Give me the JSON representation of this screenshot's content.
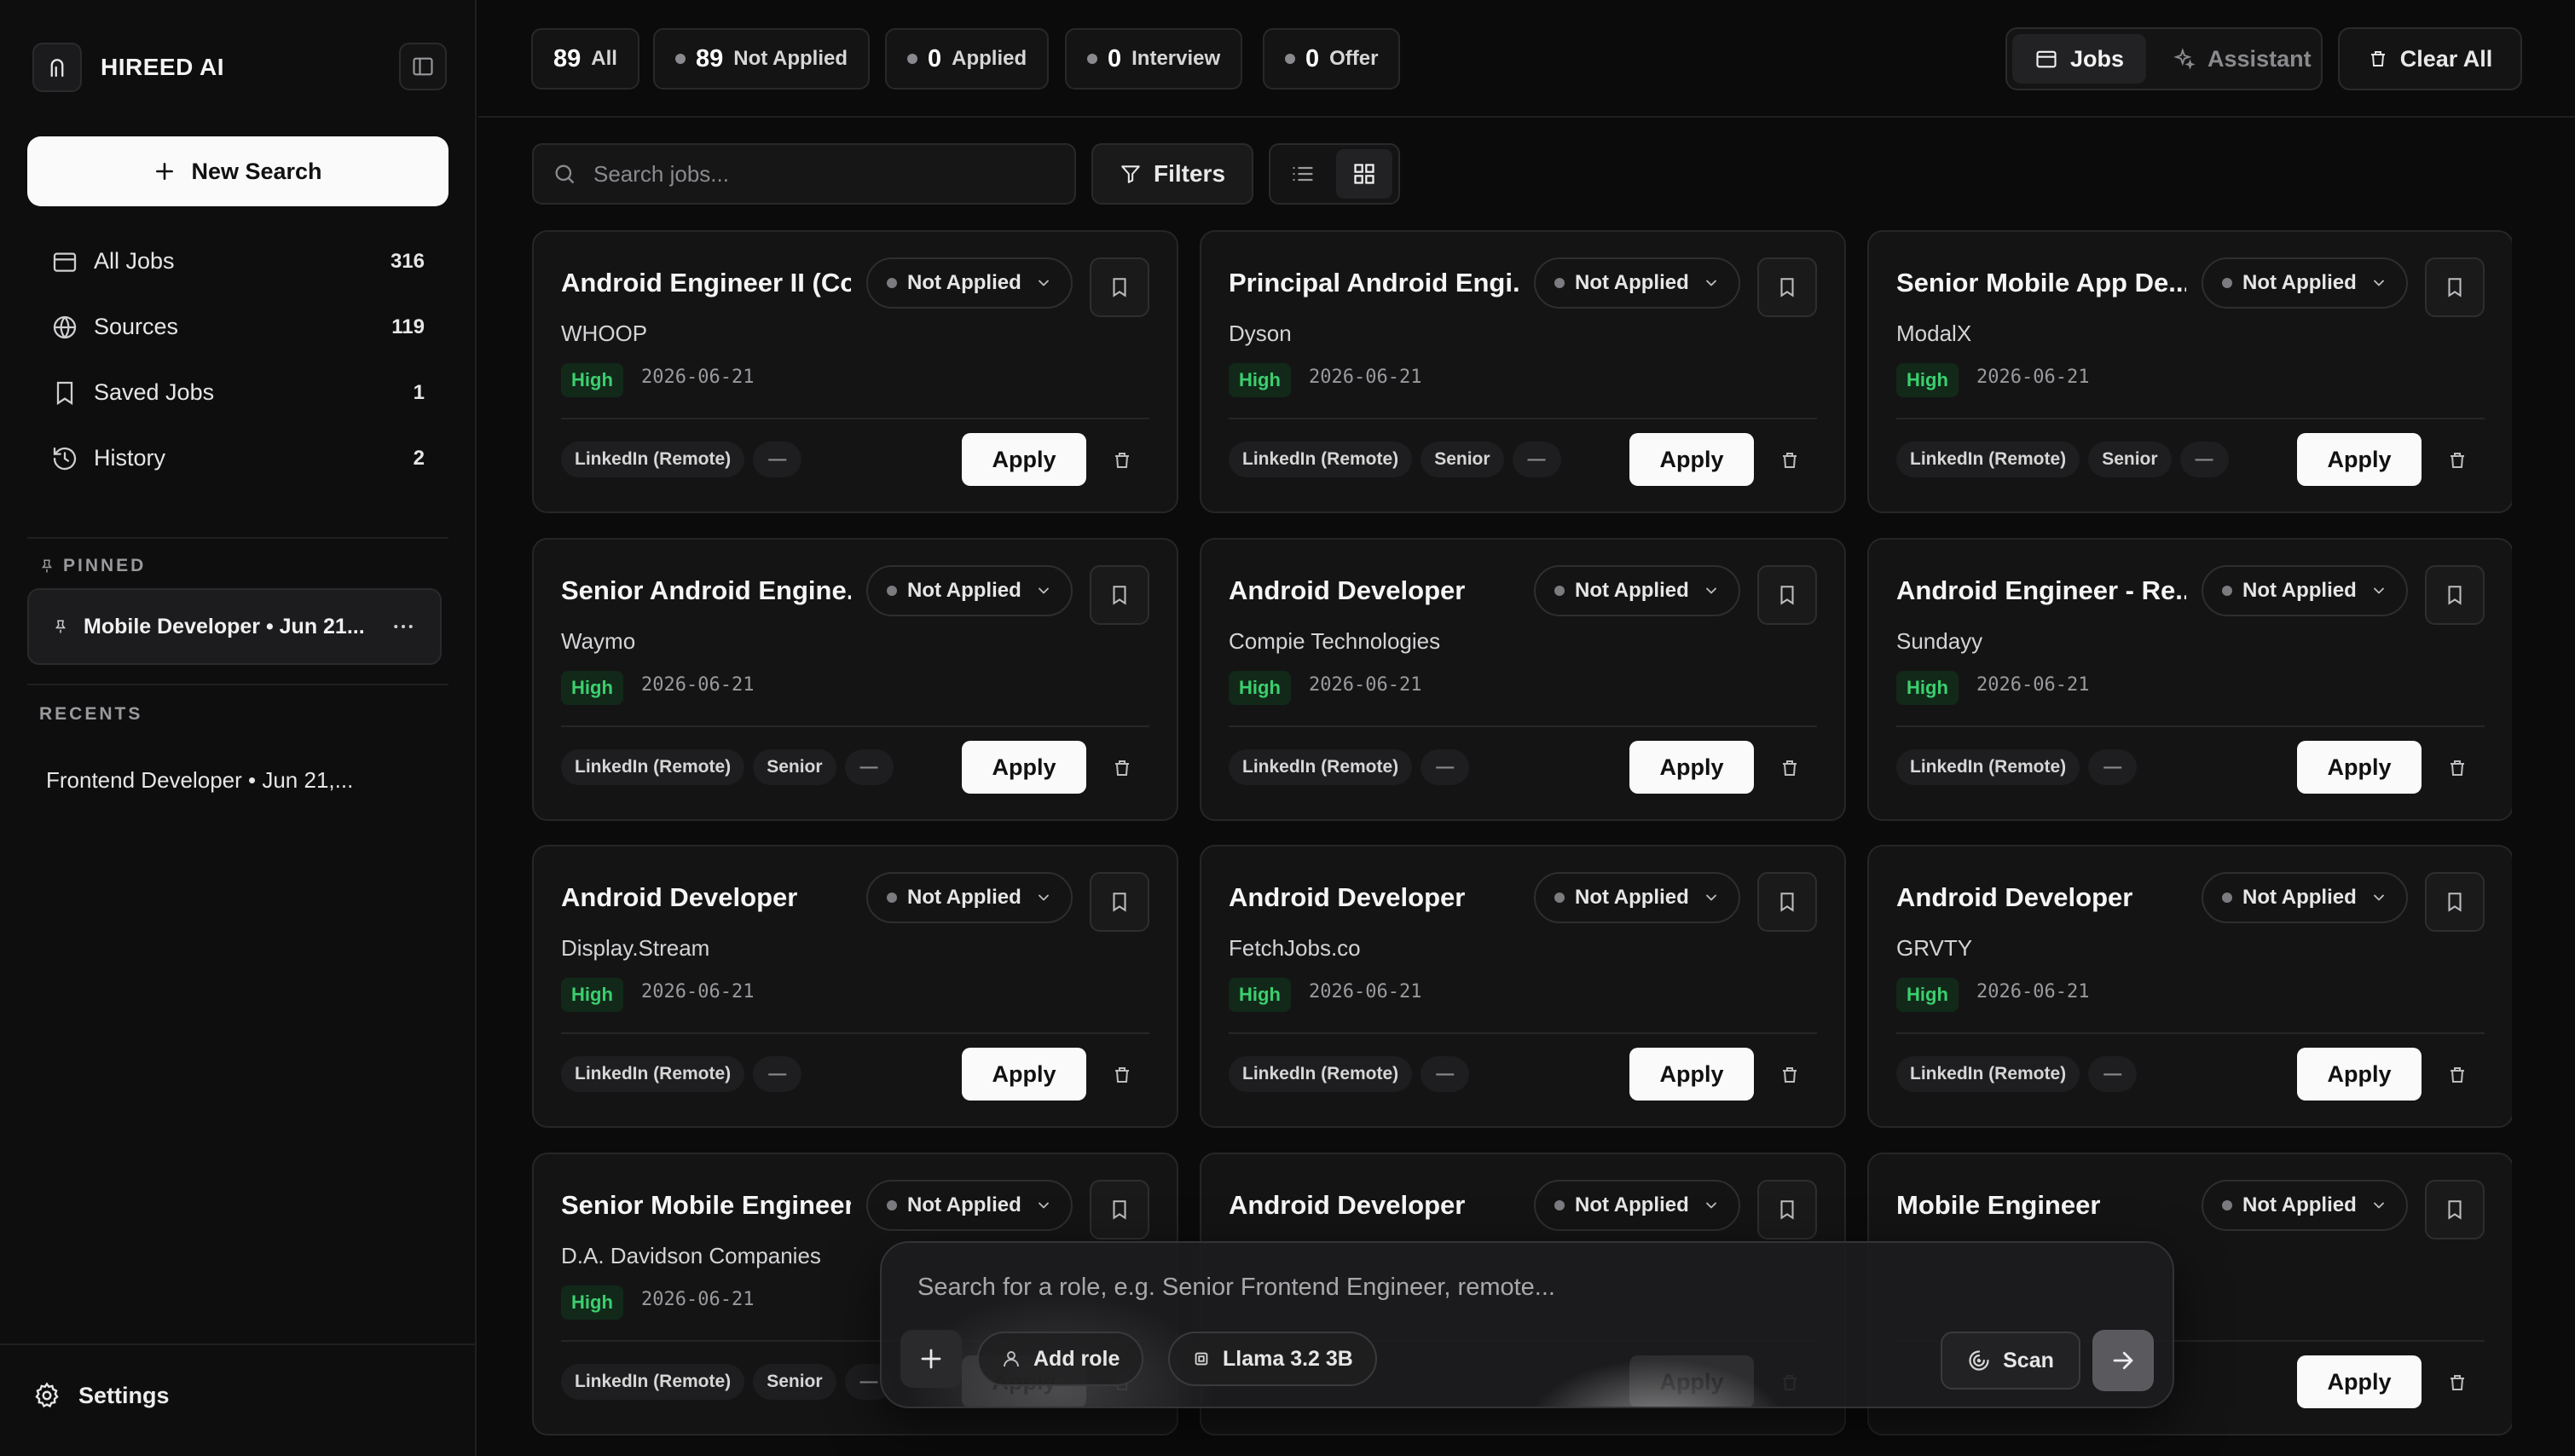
{
  "brand": {
    "name": "HIREED AI"
  },
  "sidebar": {
    "new_search_label": "New Search",
    "nav": [
      {
        "label": "All Jobs",
        "count": "316",
        "icon": "calendar-icon"
      },
      {
        "label": "Sources",
        "count": "119",
        "icon": "globe-icon"
      },
      {
        "label": "Saved Jobs",
        "count": "1",
        "icon": "bookmark-icon"
      },
      {
        "label": "History",
        "count": "2",
        "icon": "history-icon"
      }
    ],
    "pinned_label": "PINNED",
    "pinned_item": "Mobile Developer • Jun 21...",
    "recents_label": "RECENTS",
    "recent_item": "Frontend Developer • Jun 21,...",
    "settings_label": "Settings"
  },
  "topbar": {
    "status_tabs": [
      {
        "count": "89",
        "label": "All"
      },
      {
        "count": "89",
        "label": "Not Applied"
      },
      {
        "count": "0",
        "label": "Applied"
      },
      {
        "count": "0",
        "label": "Interview"
      },
      {
        "count": "0",
        "label": "Offer"
      }
    ],
    "modes": {
      "jobs": "Jobs",
      "assistant": "Assistant"
    },
    "clear_all": "Clear All"
  },
  "toolbar": {
    "search_placeholder": "Search jobs...",
    "filters_label": "Filters"
  },
  "jobs": [
    {
      "title": "Android Engineer II (Cor",
      "company": "WHOOP",
      "status": "Not Applied",
      "priority": "High",
      "date": "2026-06-21",
      "tags": [
        "LinkedIn (Remote)",
        "—"
      ]
    },
    {
      "title": "Principal Android Engi...",
      "company": "Dyson",
      "status": "Not Applied",
      "priority": "High",
      "date": "2026-06-21",
      "tags": [
        "LinkedIn (Remote)",
        "Senior",
        "—"
      ]
    },
    {
      "title": "Senior Mobile App De...",
      "company": "ModalX",
      "status": "Not Applied",
      "priority": "High",
      "date": "2026-06-21",
      "tags": [
        "LinkedIn (Remote)",
        "Senior",
        "—"
      ]
    },
    {
      "title": "Senior Android Engine...",
      "company": "Waymo",
      "status": "Not Applied",
      "priority": "High",
      "date": "2026-06-21",
      "tags": [
        "LinkedIn (Remote)",
        "Senior",
        "—"
      ]
    },
    {
      "title": "Android Developer",
      "company": "Compie Technologies",
      "status": "Not Applied",
      "priority": "High",
      "date": "2026-06-21",
      "tags": [
        "LinkedIn (Remote)",
        "—"
      ]
    },
    {
      "title": "Android Engineer - Re...",
      "company": "Sundayy",
      "status": "Not Applied",
      "priority": "High",
      "date": "2026-06-21",
      "tags": [
        "LinkedIn (Remote)",
        "—"
      ]
    },
    {
      "title": "Android Developer",
      "company": "Display.Stream",
      "status": "Not Applied",
      "priority": "High",
      "date": "2026-06-21",
      "tags": [
        "LinkedIn (Remote)",
        "—"
      ]
    },
    {
      "title": "Android Developer",
      "company": "FetchJobs.co",
      "status": "Not Applied",
      "priority": "High",
      "date": "2026-06-21",
      "tags": [
        "LinkedIn (Remote)",
        "—"
      ]
    },
    {
      "title": "Android Developer",
      "company": "GRVTY",
      "status": "Not Applied",
      "priority": "High",
      "date": "2026-06-21",
      "tags": [
        "LinkedIn (Remote)",
        "—"
      ]
    },
    {
      "title": "Senior Mobile Engineer",
      "company": "D.A. Davidson Companies",
      "status": "Not Applied",
      "priority": "High",
      "date": "2026-06-21",
      "tags": [
        "LinkedIn (Remote)",
        "Senior",
        "—"
      ]
    },
    {
      "title": "Android Developer",
      "company": "",
      "status": "Not Applied",
      "priority": "",
      "date": "",
      "tags": []
    },
    {
      "title": "Mobile Engineer",
      "company": "",
      "status": "Not Applied",
      "priority": "",
      "date": "",
      "tags": []
    }
  ],
  "apply_label": "Apply",
  "composer": {
    "placeholder": "Search for a role, e.g. Senior Frontend Engineer, remote...",
    "add_role": "Add role",
    "model": "Llama 3.2 3B",
    "scan": "Scan"
  },
  "colors": {
    "accent_high": "#3ccf6e",
    "background": "#0b0b0c",
    "card": "#141415"
  }
}
